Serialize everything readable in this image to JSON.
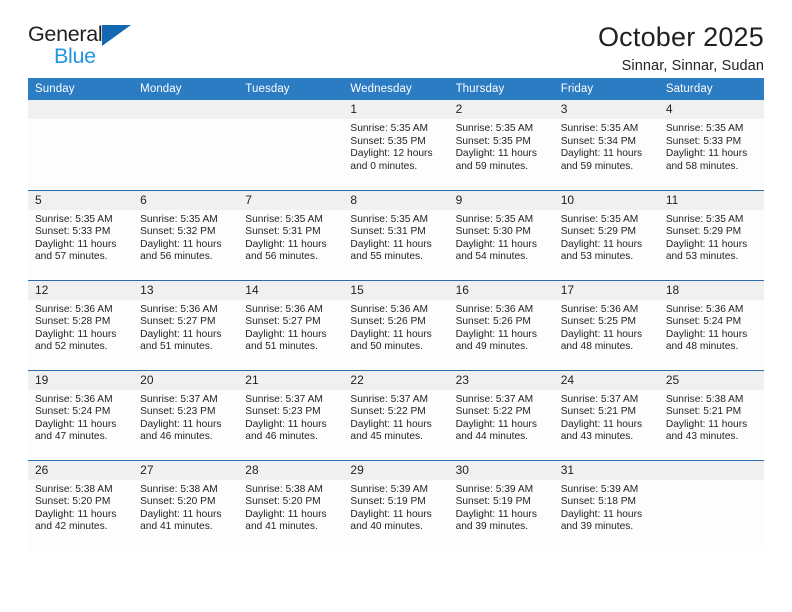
{
  "brand": {
    "name_primary": "General",
    "name_secondary": "Blue",
    "triangle_color": "#1268b3",
    "secondary_color": "#2196e3"
  },
  "header": {
    "title": "October 2025",
    "subtitle": "Sinnar, Sinnar, Sudan"
  },
  "theme": {
    "header_bar_color": "#2b7cc2",
    "row_divider_color": "#2b6cad",
    "daynum_band_color": "#f0f0f0"
  },
  "calendar": {
    "weekday_headers": [
      "Sunday",
      "Monday",
      "Tuesday",
      "Wednesday",
      "Thursday",
      "Friday",
      "Saturday"
    ],
    "weeks": [
      [
        {
          "day": "",
          "sunrise": "",
          "sunset": "",
          "daylight_line1": "",
          "daylight_line2": ""
        },
        {
          "day": "",
          "sunrise": "",
          "sunset": "",
          "daylight_line1": "",
          "daylight_line2": ""
        },
        {
          "day": "",
          "sunrise": "",
          "sunset": "",
          "daylight_line1": "",
          "daylight_line2": ""
        },
        {
          "day": "1",
          "sunrise": "Sunrise: 5:35 AM",
          "sunset": "Sunset: 5:35 PM",
          "daylight_line1": "Daylight: 12 hours",
          "daylight_line2": "and 0 minutes."
        },
        {
          "day": "2",
          "sunrise": "Sunrise: 5:35 AM",
          "sunset": "Sunset: 5:35 PM",
          "daylight_line1": "Daylight: 11 hours",
          "daylight_line2": "and 59 minutes."
        },
        {
          "day": "3",
          "sunrise": "Sunrise: 5:35 AM",
          "sunset": "Sunset: 5:34 PM",
          "daylight_line1": "Daylight: 11 hours",
          "daylight_line2": "and 59 minutes."
        },
        {
          "day": "4",
          "sunrise": "Sunrise: 5:35 AM",
          "sunset": "Sunset: 5:33 PM",
          "daylight_line1": "Daylight: 11 hours",
          "daylight_line2": "and 58 minutes."
        }
      ],
      [
        {
          "day": "5",
          "sunrise": "Sunrise: 5:35 AM",
          "sunset": "Sunset: 5:33 PM",
          "daylight_line1": "Daylight: 11 hours",
          "daylight_line2": "and 57 minutes."
        },
        {
          "day": "6",
          "sunrise": "Sunrise: 5:35 AM",
          "sunset": "Sunset: 5:32 PM",
          "daylight_line1": "Daylight: 11 hours",
          "daylight_line2": "and 56 minutes."
        },
        {
          "day": "7",
          "sunrise": "Sunrise: 5:35 AM",
          "sunset": "Sunset: 5:31 PM",
          "daylight_line1": "Daylight: 11 hours",
          "daylight_line2": "and 56 minutes."
        },
        {
          "day": "8",
          "sunrise": "Sunrise: 5:35 AM",
          "sunset": "Sunset: 5:31 PM",
          "daylight_line1": "Daylight: 11 hours",
          "daylight_line2": "and 55 minutes."
        },
        {
          "day": "9",
          "sunrise": "Sunrise: 5:35 AM",
          "sunset": "Sunset: 5:30 PM",
          "daylight_line1": "Daylight: 11 hours",
          "daylight_line2": "and 54 minutes."
        },
        {
          "day": "10",
          "sunrise": "Sunrise: 5:35 AM",
          "sunset": "Sunset: 5:29 PM",
          "daylight_line1": "Daylight: 11 hours",
          "daylight_line2": "and 53 minutes."
        },
        {
          "day": "11",
          "sunrise": "Sunrise: 5:35 AM",
          "sunset": "Sunset: 5:29 PM",
          "daylight_line1": "Daylight: 11 hours",
          "daylight_line2": "and 53 minutes."
        }
      ],
      [
        {
          "day": "12",
          "sunrise": "Sunrise: 5:36 AM",
          "sunset": "Sunset: 5:28 PM",
          "daylight_line1": "Daylight: 11 hours",
          "daylight_line2": "and 52 minutes."
        },
        {
          "day": "13",
          "sunrise": "Sunrise: 5:36 AM",
          "sunset": "Sunset: 5:27 PM",
          "daylight_line1": "Daylight: 11 hours",
          "daylight_line2": "and 51 minutes."
        },
        {
          "day": "14",
          "sunrise": "Sunrise: 5:36 AM",
          "sunset": "Sunset: 5:27 PM",
          "daylight_line1": "Daylight: 11 hours",
          "daylight_line2": "and 51 minutes."
        },
        {
          "day": "15",
          "sunrise": "Sunrise: 5:36 AM",
          "sunset": "Sunset: 5:26 PM",
          "daylight_line1": "Daylight: 11 hours",
          "daylight_line2": "and 50 minutes."
        },
        {
          "day": "16",
          "sunrise": "Sunrise: 5:36 AM",
          "sunset": "Sunset: 5:26 PM",
          "daylight_line1": "Daylight: 11 hours",
          "daylight_line2": "and 49 minutes."
        },
        {
          "day": "17",
          "sunrise": "Sunrise: 5:36 AM",
          "sunset": "Sunset: 5:25 PM",
          "daylight_line1": "Daylight: 11 hours",
          "daylight_line2": "and 48 minutes."
        },
        {
          "day": "18",
          "sunrise": "Sunrise: 5:36 AM",
          "sunset": "Sunset: 5:24 PM",
          "daylight_line1": "Daylight: 11 hours",
          "daylight_line2": "and 48 minutes."
        }
      ],
      [
        {
          "day": "19",
          "sunrise": "Sunrise: 5:36 AM",
          "sunset": "Sunset: 5:24 PM",
          "daylight_line1": "Daylight: 11 hours",
          "daylight_line2": "and 47 minutes."
        },
        {
          "day": "20",
          "sunrise": "Sunrise: 5:37 AM",
          "sunset": "Sunset: 5:23 PM",
          "daylight_line1": "Daylight: 11 hours",
          "daylight_line2": "and 46 minutes."
        },
        {
          "day": "21",
          "sunrise": "Sunrise: 5:37 AM",
          "sunset": "Sunset: 5:23 PM",
          "daylight_line1": "Daylight: 11 hours",
          "daylight_line2": "and 46 minutes."
        },
        {
          "day": "22",
          "sunrise": "Sunrise: 5:37 AM",
          "sunset": "Sunset: 5:22 PM",
          "daylight_line1": "Daylight: 11 hours",
          "daylight_line2": "and 45 minutes."
        },
        {
          "day": "23",
          "sunrise": "Sunrise: 5:37 AM",
          "sunset": "Sunset: 5:22 PM",
          "daylight_line1": "Daylight: 11 hours",
          "daylight_line2": "and 44 minutes."
        },
        {
          "day": "24",
          "sunrise": "Sunrise: 5:37 AM",
          "sunset": "Sunset: 5:21 PM",
          "daylight_line1": "Daylight: 11 hours",
          "daylight_line2": "and 43 minutes."
        },
        {
          "day": "25",
          "sunrise": "Sunrise: 5:38 AM",
          "sunset": "Sunset: 5:21 PM",
          "daylight_line1": "Daylight: 11 hours",
          "daylight_line2": "and 43 minutes."
        }
      ],
      [
        {
          "day": "26",
          "sunrise": "Sunrise: 5:38 AM",
          "sunset": "Sunset: 5:20 PM",
          "daylight_line1": "Daylight: 11 hours",
          "daylight_line2": "and 42 minutes."
        },
        {
          "day": "27",
          "sunrise": "Sunrise: 5:38 AM",
          "sunset": "Sunset: 5:20 PM",
          "daylight_line1": "Daylight: 11 hours",
          "daylight_line2": "and 41 minutes."
        },
        {
          "day": "28",
          "sunrise": "Sunrise: 5:38 AM",
          "sunset": "Sunset: 5:20 PM",
          "daylight_line1": "Daylight: 11 hours",
          "daylight_line2": "and 41 minutes."
        },
        {
          "day": "29",
          "sunrise": "Sunrise: 5:39 AM",
          "sunset": "Sunset: 5:19 PM",
          "daylight_line1": "Daylight: 11 hours",
          "daylight_line2": "and 40 minutes."
        },
        {
          "day": "30",
          "sunrise": "Sunrise: 5:39 AM",
          "sunset": "Sunset: 5:19 PM",
          "daylight_line1": "Daylight: 11 hours",
          "daylight_line2": "and 39 minutes."
        },
        {
          "day": "31",
          "sunrise": "Sunrise: 5:39 AM",
          "sunset": "Sunset: 5:18 PM",
          "daylight_line1": "Daylight: 11 hours",
          "daylight_line2": "and 39 minutes."
        },
        {
          "day": "",
          "sunrise": "",
          "sunset": "",
          "daylight_line1": "",
          "daylight_line2": ""
        }
      ]
    ]
  }
}
